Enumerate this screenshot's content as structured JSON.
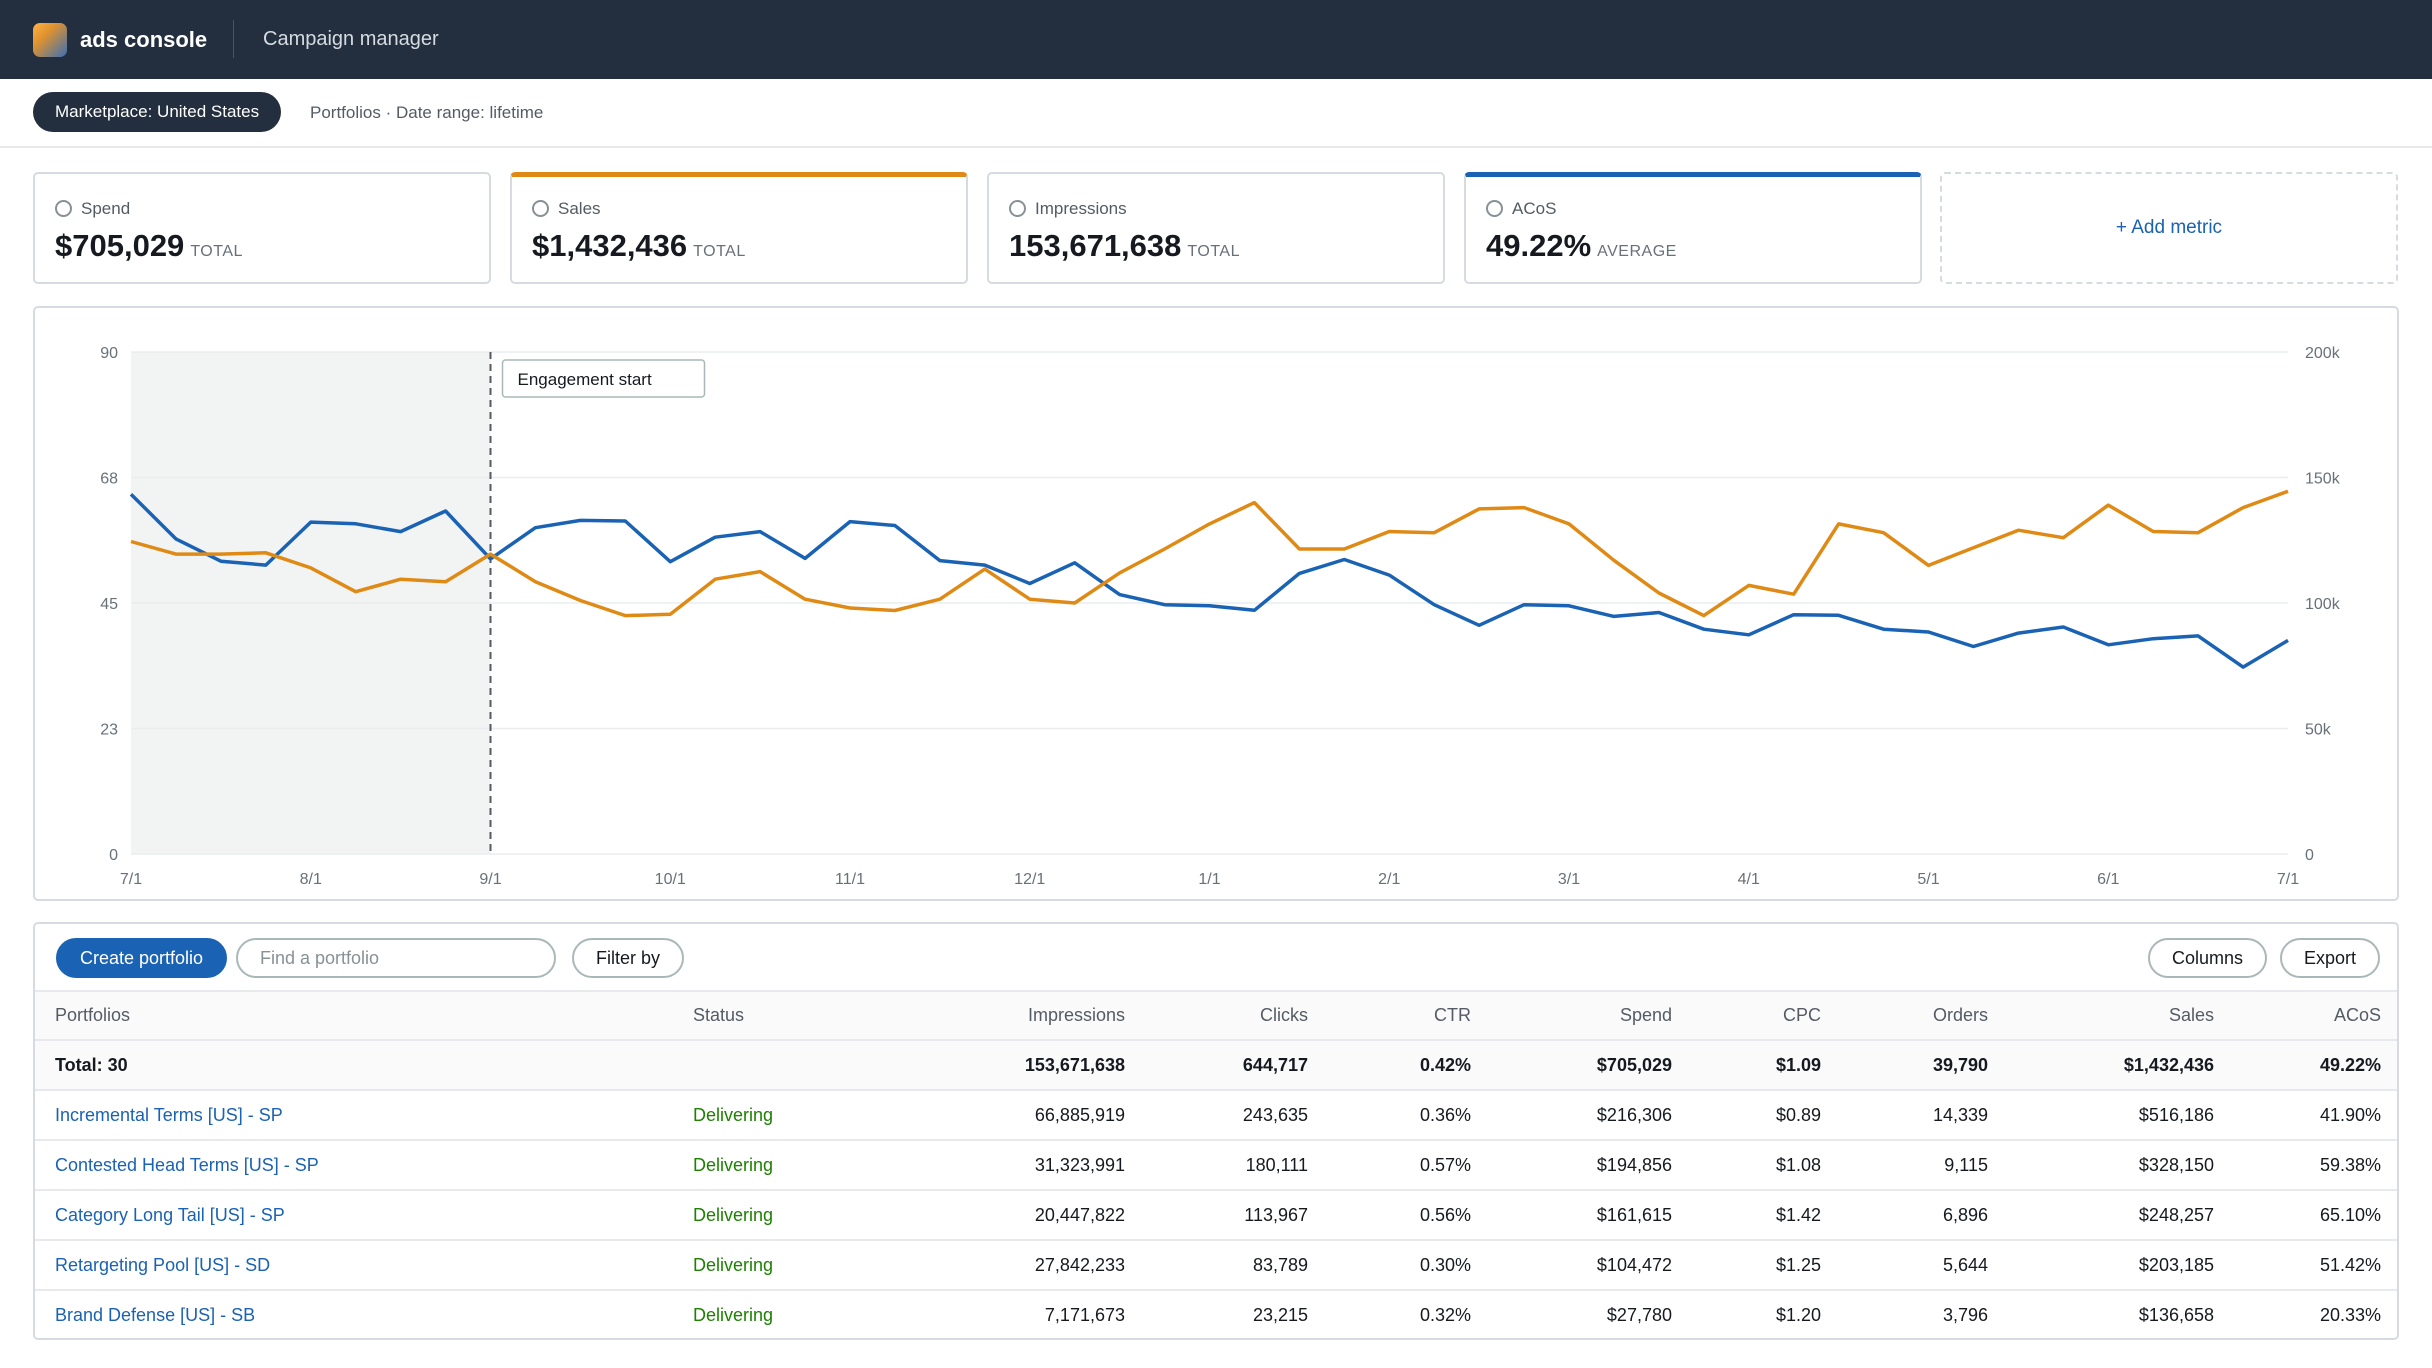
{
  "header": {
    "brand": "ads console",
    "app": "Campaign manager"
  },
  "subheader": {
    "marketplace": "Marketplace: United States",
    "breadcrumb": "Portfolios · Date range: lifetime"
  },
  "metrics": [
    {
      "label": "Spend",
      "value": "$705,029",
      "sub": "TOTAL",
      "selected": false
    },
    {
      "label": "Sales",
      "value": "$1,432,436",
      "sub": "TOTAL",
      "selected": true,
      "color": "#e08a16"
    },
    {
      "label": "Impressions",
      "value": "153,671,638",
      "sub": "TOTAL",
      "selected": false
    },
    {
      "label": "ACoS",
      "value": "49.22%",
      "sub": "AVERAGE",
      "selected": true,
      "color": "#1a62b4"
    }
  ],
  "add_metric_label": "+ Add metric",
  "chart_data": {
    "type": "line",
    "x": [
      "7/1",
      "8/1",
      "9/1",
      "10/1",
      "11/1",
      "12/1",
      "1/1",
      "2/1",
      "3/1",
      "4/1",
      "5/1",
      "6/1",
      "7/1"
    ],
    "annotation": "Engagement start",
    "annotation_x_index": 2,
    "y_left_ticks": [
      "0",
      "23",
      "45",
      "68",
      "90"
    ],
    "y_left_range": [
      0,
      90
    ],
    "y_right_ticks": [
      "0",
      "50k",
      "100k",
      "150k",
      "200k"
    ],
    "y_right_range": [
      0,
      200000
    ],
    "grid": true,
    "series": [
      {
        "name": "ACoS",
        "axis": "left",
        "color": "#1a62b4",
        "values": [
          64.5,
          56.5,
          52.5,
          51.8,
          59.5,
          59.2,
          57.8,
          61.5,
          52.9,
          58.5,
          59.8,
          59.7,
          52.4,
          56.8,
          57.8,
          53,
          59.6,
          58.9,
          52.6,
          51.8,
          48.5,
          52.2,
          46.5,
          44.7,
          44.5,
          43.7,
          50.3,
          52.8,
          50,
          44.7,
          41,
          44.7,
          44.5,
          42.6,
          43.3,
          40.3,
          39.3,
          42.9,
          42.8,
          40.3,
          39.8,
          37.2,
          39.6,
          40.7,
          37.5,
          38.6,
          39.1,
          33.5,
          38.3
        ]
      },
      {
        "name": "Sales",
        "axis": "right",
        "color": "#e08a16",
        "values": [
          124500,
          119500,
          119500,
          120000,
          114000,
          104500,
          109500,
          108500,
          119500,
          108500,
          101000,
          95000,
          95500,
          109500,
          112500,
          101500,
          98000,
          97000,
          101500,
          113500,
          101500,
          100000,
          112000,
          121500,
          131500,
          140000,
          121500,
          121500,
          128500,
          128000,
          137500,
          138000,
          131500,
          117000,
          104000,
          95000,
          107000,
          103500,
          131500,
          128000,
          115000,
          122000,
          129000,
          126000,
          139000,
          128500,
          128000,
          138000,
          144500
        ]
      }
    ]
  },
  "table": {
    "toolbar": {
      "create": "Create portfolio",
      "search_placeholder": "Find a portfolio",
      "filter": "Filter by",
      "columns": "Columns",
      "export": "Export"
    },
    "headers": [
      "Portfolios",
      "Status",
      "Impressions",
      "Clicks",
      "CTR",
      "Spend",
      "CPC",
      "Orders",
      "Sales",
      "ACoS"
    ],
    "total": [
      "Total: 30",
      "",
      "153,671,638",
      "644,717",
      "0.42%",
      "$705,029",
      "$1.09",
      "39,790",
      "$1,432,436",
      "49.22%"
    ],
    "rows": [
      [
        "Incremental Terms [US] - SP",
        "Delivering",
        "66,885,919",
        "243,635",
        "0.36%",
        "$216,306",
        "$0.89",
        "14,339",
        "$516,186",
        "41.90%"
      ],
      [
        "Contested Head Terms [US] - SP",
        "Delivering",
        "31,323,991",
        "180,111",
        "0.57%",
        "$194,856",
        "$1.08",
        "9,115",
        "$328,150",
        "59.38%"
      ],
      [
        "Category Long Tail [US] - SP",
        "Delivering",
        "20,447,822",
        "113,967",
        "0.56%",
        "$161,615",
        "$1.42",
        "6,896",
        "$248,257",
        "65.10%"
      ],
      [
        "Retargeting Pool [US] - SD",
        "Delivering",
        "27,842,233",
        "83,789",
        "0.30%",
        "$104,472",
        "$1.25",
        "5,644",
        "$203,185",
        "51.42%"
      ],
      [
        "Brand Defense [US] - SB",
        "Delivering",
        "7,171,673",
        "23,215",
        "0.32%",
        "$27,780",
        "$1.20",
        "3,796",
        "$136,658",
        "20.33%"
      ]
    ]
  }
}
